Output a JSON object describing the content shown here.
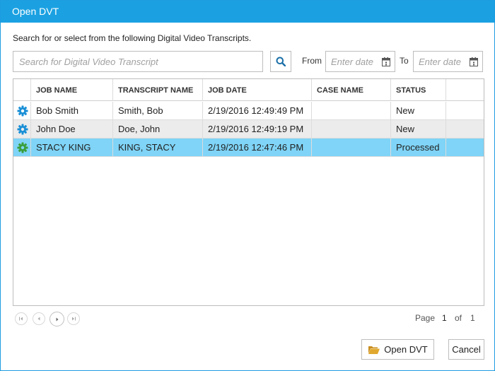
{
  "window": {
    "title": "Open DVT"
  },
  "instructions": "Search for or select from the following Digital Video Transcripts.",
  "search": {
    "placeholder": "Search for Digital Video Transcript",
    "value": ""
  },
  "date_filter": {
    "from_label": "From",
    "to_label": "To",
    "from_placeholder": "Enter date",
    "to_placeholder": "Enter date"
  },
  "grid": {
    "columns": [
      "JOB NAME",
      "TRANSCRIPT NAME",
      "JOB DATE",
      "CASE NAME",
      "STATUS"
    ],
    "rows": [
      {
        "icon": "gear-icon",
        "icon_color": "#1a8fd6",
        "job_name": "Bob Smith",
        "transcript_name": "Smith, Bob",
        "job_date": "2/19/2016 12:49:49 PM",
        "case_name": "",
        "status": "New",
        "selected": false
      },
      {
        "icon": "gear-icon",
        "icon_color": "#1a8fd6",
        "job_name": "John Doe",
        "transcript_name": "Doe, John",
        "job_date": "2/19/2016 12:49:19 PM",
        "case_name": "",
        "status": "New",
        "selected": false
      },
      {
        "icon": "gear-icon",
        "icon_color": "#3a9e3a",
        "job_name": "STACY KING",
        "transcript_name": "KING, STACY",
        "job_date": "2/19/2016 12:47:46 PM",
        "case_name": "",
        "status": "Processed",
        "selected": true
      }
    ]
  },
  "pager": {
    "page_label": "Page",
    "current_page": "1",
    "of_label": "of",
    "total_pages": "1",
    "buttons": [
      "first-page-icon",
      "prev-page-icon",
      "next-page-icon",
      "last-page-icon"
    ]
  },
  "buttons": {
    "open_label": "Open DVT",
    "cancel_label": "Cancel"
  },
  "colors": {
    "titlebar": "#1ba1e2",
    "selected_row": "#7fd4f7",
    "alt_row": "#ececec",
    "search_icon": "#1a6fa8",
    "folder_icon": "#e0a82e"
  }
}
